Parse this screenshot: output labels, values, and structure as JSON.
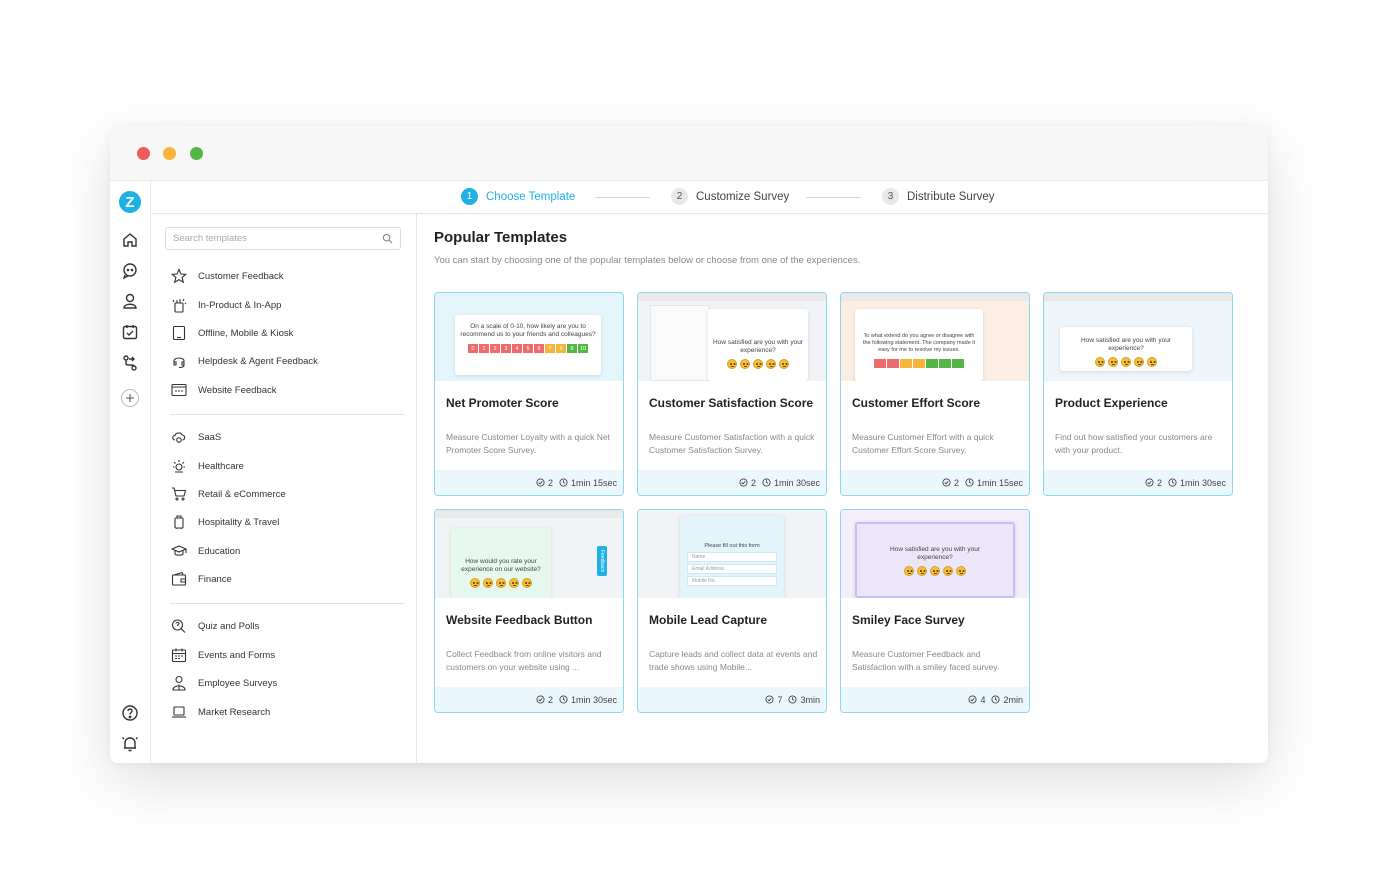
{
  "colors": {
    "accent": "#1fb1e6",
    "card_border": "#8fd6f1",
    "footer_bg": "#eaf8fd"
  },
  "rail": {
    "logo": "Z",
    "icons": [
      "home-icon",
      "chat-icon",
      "user-icon",
      "calendar-check-icon",
      "workflow-icon",
      "add-icon",
      "help-icon",
      "notification-bell-icon"
    ]
  },
  "steps": [
    {
      "num": "1",
      "label": "Choose Template",
      "active": true
    },
    {
      "num": "2",
      "label": "Customize Survey",
      "active": false
    },
    {
      "num": "3",
      "label": "Distribute Survey",
      "active": false
    }
  ],
  "search": {
    "placeholder": "Search templates"
  },
  "categories": [
    {
      "label": "Customer Feedback",
      "icon": "star-icon"
    },
    {
      "label": "In-Product & In-App",
      "icon": "sparkle-hand-icon"
    },
    {
      "label": "Offline, Mobile & Kiosk",
      "icon": "tablet-icon"
    },
    {
      "label": "Helpdesk & Agent Feedback",
      "icon": "headset-icon"
    },
    {
      "label": "Website Feedback",
      "icon": "browser-icon"
    },
    {
      "label": "SaaS",
      "icon": "cloud-gear-icon"
    },
    {
      "label": "Healthcare",
      "icon": "health-icon"
    },
    {
      "label": "Retail & eCommerce",
      "icon": "cart-icon"
    },
    {
      "label": "Hospitality & Travel",
      "icon": "luggage-icon"
    },
    {
      "label": "Education",
      "icon": "graduation-cap-icon"
    },
    {
      "label": "Finance",
      "icon": "wallet-icon"
    },
    {
      "label": "Quiz and Polls",
      "icon": "quiz-icon"
    },
    {
      "label": "Events and Forms",
      "icon": "calendar-icon"
    },
    {
      "label": "Employee Surveys",
      "icon": "employee-icon"
    },
    {
      "label": "Market Research",
      "icon": "laptop-icon"
    }
  ],
  "main": {
    "title": "Popular Templates",
    "subtitle": "You can start by choosing one of the popular templates below or choose from one of the experiences."
  },
  "templates": [
    {
      "title": "Net Promoter Score",
      "desc": "Measure Customer Loyalty with a quick Net Promoter Score Survey.",
      "questions": "2",
      "time": "1min 15sec",
      "preview": "On a scale of 0-10, how likely are you to recommend us to your friends and colleagues?",
      "scale": [
        "0",
        "1",
        "2",
        "3",
        "4",
        "5",
        "6",
        "7",
        "8",
        "9",
        "10"
      ]
    },
    {
      "title": "Customer Satisfaction Score",
      "desc": "Measure Customer Satisfaction with a quick Customer Satisfaction Survey.",
      "questions": "2",
      "time": "1min 30sec",
      "preview": "How satisfied are you with your experience?"
    },
    {
      "title": "Customer Effort Score",
      "desc": "Measure Customer Effort with a quick Customer Effort Score Survey.",
      "questions": "2",
      "time": "1min 15sec",
      "preview": "To what extend do you agree or disagree with the following statement. The company made it easy for me to resolve my issues."
    },
    {
      "title": "Product Experience",
      "desc": "Find out how satisfied your customers are with your product.",
      "questions": "2",
      "time": "1min 30sec",
      "preview": "How satisfied are you with your experience?"
    },
    {
      "title": "Website Feedback Button",
      "desc": "Collect Feedback from online visitors and customers on your website using ...",
      "questions": "2",
      "time": "1min 30sec",
      "preview": "How would you rate your experience on our website?",
      "tab": "Feedback"
    },
    {
      "title": "Mobile Lead Capture",
      "desc": "Capture leads and collect data at events and trade shows using Mobile...",
      "questions": "7",
      "time": "3min",
      "preview": "Please fill out this form",
      "fields": [
        "Name",
        "Email Address",
        "Mobile No."
      ]
    },
    {
      "title": "Smiley Face Survey",
      "desc": "Measure Customer Feedback and Satisfaction with a smiley faced survey.",
      "questions": "4",
      "time": "2min",
      "preview": "How satisfied are you with your experience?"
    }
  ]
}
